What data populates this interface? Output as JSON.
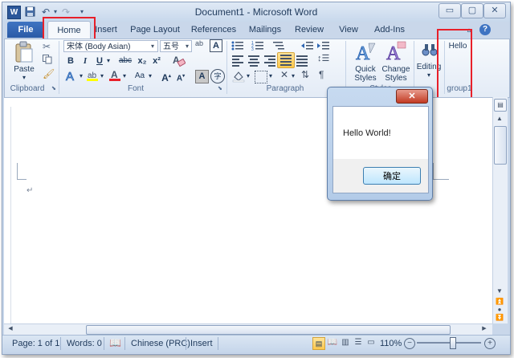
{
  "window": {
    "title": "Document1 - Microsoft Word",
    "word_icon_text": "W",
    "min_label": "▭",
    "max_label": "▢",
    "close_label": "✕"
  },
  "tabs": {
    "file": "File",
    "home": "Home",
    "insert": "Insert",
    "page_layout": "Page Layout",
    "references": "References",
    "mailings": "Mailings",
    "review": "Review",
    "view": "View",
    "addins": "Add-Ins"
  },
  "clipboard": {
    "paste": "Paste",
    "label": "Clipboard"
  },
  "font": {
    "name": "宋体 (Body Asian)",
    "size": "五号",
    "bold": "B",
    "italic": "I",
    "underline": "U",
    "strike": "abc",
    "subscript": "x₂",
    "superscript": "x²",
    "grow": "A",
    "shrink": "A",
    "case": "Aa",
    "clear": "A",
    "phonetic": "ab",
    "char_border": "A",
    "enclose": "字",
    "label": "Font"
  },
  "paragraph": {
    "label": "Paragraph"
  },
  "styles": {
    "quick_styles": "Quick Styles",
    "change_styles": "Change Styles",
    "label": "Styles"
  },
  "editing": {
    "label": "Editing"
  },
  "group1": {
    "button": "Hello",
    "label": "group1"
  },
  "dialog": {
    "message": "Hello World!",
    "ok": "确定",
    "close": "✕"
  },
  "status": {
    "page": "Page: 1 of 1",
    "words": "Words: 0",
    "language": "Chinese (PRC)",
    "mode": "Insert",
    "zoom": "110%",
    "zoom_level": 0.55
  },
  "colors": {
    "highlight": "#ffff00",
    "font_color": "#e8202a",
    "annotation_box": "#e8202a"
  }
}
